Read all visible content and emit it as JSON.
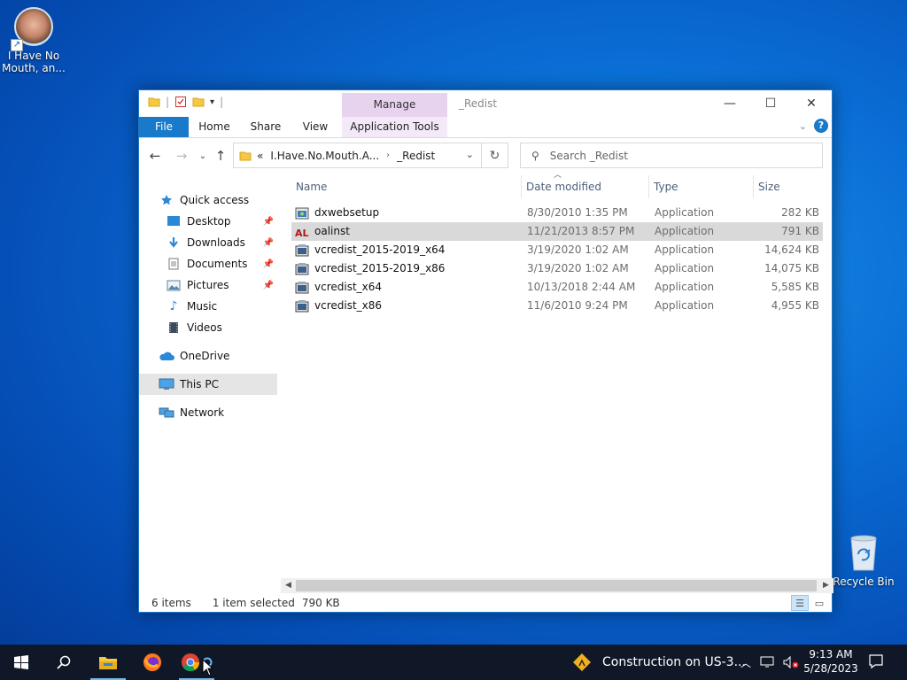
{
  "desktop": {
    "game_shortcut_label": "I Have No Mouth, an...",
    "recycle_bin_label": "Recycle Bin"
  },
  "window": {
    "context_tab": "Manage",
    "title": "_Redist",
    "ribbon_tabs": [
      "File",
      "Home",
      "Share",
      "View",
      "Application Tools"
    ],
    "address": {
      "overflow": "«",
      "segments": [
        "I.Have.No.Mouth.A...",
        "_Redist"
      ]
    },
    "search_placeholder": "Search _Redist",
    "sidebar": [
      {
        "label": "Quick access",
        "icon": "star-icon",
        "pinned": false
      },
      {
        "label": "Desktop",
        "icon": "desktop-icon",
        "pinned": true
      },
      {
        "label": "Downloads",
        "icon": "downloads-icon",
        "pinned": true
      },
      {
        "label": "Documents",
        "icon": "documents-icon",
        "pinned": true
      },
      {
        "label": "Pictures",
        "icon": "pictures-icon",
        "pinned": true
      },
      {
        "label": "Music",
        "icon": "music-icon",
        "pinned": false
      },
      {
        "label": "Videos",
        "icon": "videos-icon",
        "pinned": false
      },
      {
        "label": "OneDrive",
        "icon": "cloud-icon",
        "pinned": false
      },
      {
        "label": "This PC",
        "icon": "computer-icon",
        "pinned": false
      },
      {
        "label": "Network",
        "icon": "network-icon",
        "pinned": false
      }
    ],
    "columns": [
      "Name",
      "Date modified",
      "Type",
      "Size"
    ],
    "files": [
      {
        "name": "dxwebsetup",
        "date": "8/30/2010 1:35 PM",
        "type": "Application",
        "size": "282 KB"
      },
      {
        "name": "oalinst",
        "date": "11/21/2013 8:57 PM",
        "type": "Application",
        "size": "791 KB"
      },
      {
        "name": "vcredist_2015-2019_x64",
        "date": "3/19/2020 1:02 AM",
        "type": "Application",
        "size": "14,624 KB"
      },
      {
        "name": "vcredist_2015-2019_x86",
        "date": "3/19/2020 1:02 AM",
        "type": "Application",
        "size": "14,075 KB"
      },
      {
        "name": "vcredist_x64",
        "date": "10/13/2018 2:44 AM",
        "type": "Application",
        "size": "5,585 KB"
      },
      {
        "name": "vcredist_x86",
        "date": "11/6/2010 9:24 PM",
        "type": "Application",
        "size": "4,955 KB"
      }
    ],
    "selected_file": "oalinst",
    "status": {
      "items": "6 items",
      "selected": "1 item selected",
      "selected_size": "790 KB"
    }
  },
  "taskbar": {
    "news_text": "Construction on US-3...",
    "time": "9:13 AM",
    "date": "5/28/2023"
  },
  "colors": {
    "accent": "#1979ca",
    "context_tab": "#e8d3ef",
    "selection": "#d9d9d9",
    "taskbar": "#101828"
  }
}
